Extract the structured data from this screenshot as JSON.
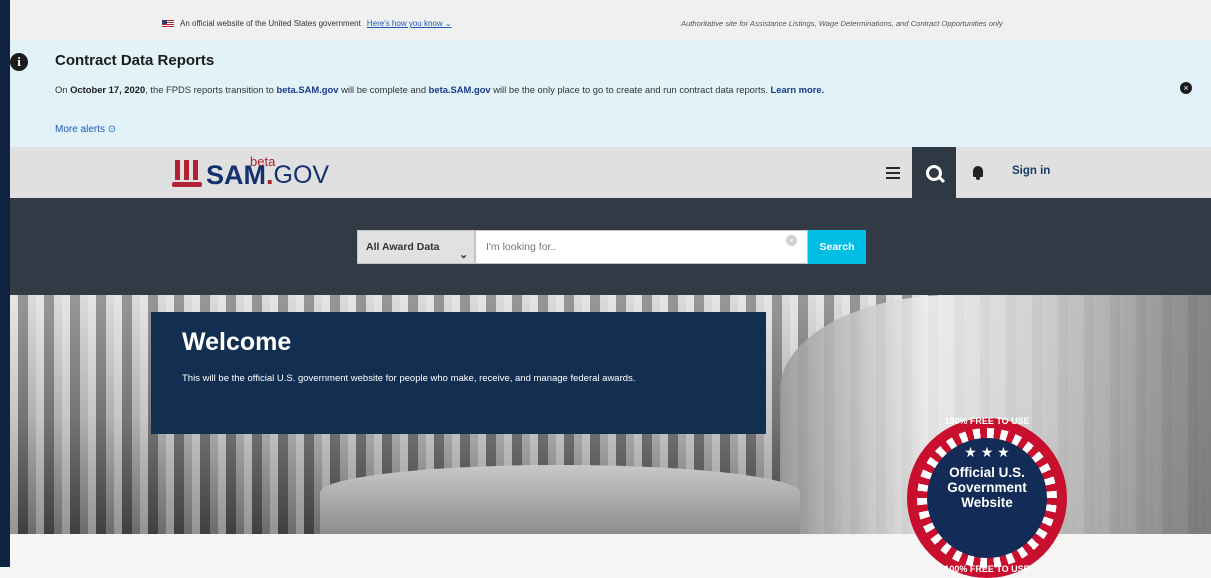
{
  "gov_banner": {
    "official_text": "An official website of the United States government",
    "how_know_link": "Here's how you know",
    "right_text": "Authoritative site for Assistance Listings, Wage Determinations, and Contract Opportunities only"
  },
  "alert": {
    "icon": "info-icon",
    "title": "Contract Data Reports",
    "body_on": "On",
    "body_date": "October 17, 2020",
    "body_mid1": ", the FPDS reports transition to",
    "link1": "beta.SAM.gov",
    "body_mid2": "will be complete and",
    "link2": "beta.SAM.gov",
    "body_mid3": "will be the only place to go to create and run contract data reports.",
    "learn_more": "Learn more.",
    "more_alerts": "More alerts",
    "close_icon": "close-icon"
  },
  "header": {
    "logo_sam": "SAM",
    "logo_dot": ".",
    "logo_gov": "GOV",
    "logo_beta": "beta",
    "signin": "Sign in"
  },
  "search": {
    "filter_label": "All Award Data",
    "placeholder": "I'm looking for..",
    "button": "Search"
  },
  "hero": {
    "welcome_title": "Welcome",
    "welcome_text": "This will be the official U.S. government website for people who make, receive, and manage federal awards."
  },
  "badge": {
    "top_arc": "100% FREE TO USE",
    "line1": "Official U.S.",
    "line2": "Government",
    "line3": "Website",
    "bottom_arc": "100% FREE TO USE",
    "stars": "★ ★ ★"
  },
  "colors": {
    "navy": "#122e51",
    "search_band": "#323a45",
    "accent_cyan": "#00bde3",
    "alert_bg": "#e1f3f8",
    "brand_red": "#b22234"
  }
}
